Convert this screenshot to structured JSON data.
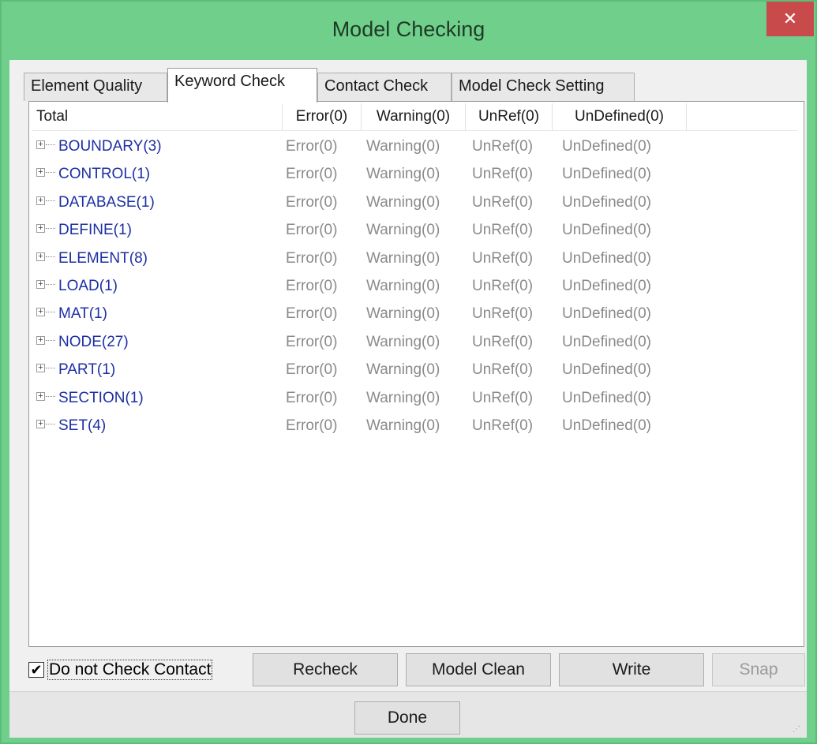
{
  "window": {
    "title": "Model Checking",
    "close_glyph": "✕"
  },
  "tabs": [
    {
      "label": "Element Quality"
    },
    {
      "label": "Keyword Check"
    },
    {
      "label": "Contact Check"
    },
    {
      "label": "Model Check Setting"
    }
  ],
  "active_tab": "Keyword Check",
  "columns": [
    "Total",
    "Error(0)",
    "Warning(0)",
    "UnRef(0)",
    "UnDefined(0)"
  ],
  "rows": [
    {
      "name": "BOUNDARY(3)",
      "error": "Error(0)",
      "warning": "Warning(0)",
      "unref": "UnRef(0)",
      "undefined": "UnDefined(0)"
    },
    {
      "name": "CONTROL(1)",
      "error": "Error(0)",
      "warning": "Warning(0)",
      "unref": "UnRef(0)",
      "undefined": "UnDefined(0)"
    },
    {
      "name": "DATABASE(1)",
      "error": "Error(0)",
      "warning": "Warning(0)",
      "unref": "UnRef(0)",
      "undefined": "UnDefined(0)"
    },
    {
      "name": "DEFINE(1)",
      "error": "Error(0)",
      "warning": "Warning(0)",
      "unref": "UnRef(0)",
      "undefined": "UnDefined(0)"
    },
    {
      "name": "ELEMENT(8)",
      "error": "Error(0)",
      "warning": "Warning(0)",
      "unref": "UnRef(0)",
      "undefined": "UnDefined(0)"
    },
    {
      "name": "LOAD(1)",
      "error": "Error(0)",
      "warning": "Warning(0)",
      "unref": "UnRef(0)",
      "undefined": "UnDefined(0)"
    },
    {
      "name": "MAT(1)",
      "error": "Error(0)",
      "warning": "Warning(0)",
      "unref": "UnRef(0)",
      "undefined": "UnDefined(0)"
    },
    {
      "name": "NODE(27)",
      "error": "Error(0)",
      "warning": "Warning(0)",
      "unref": "UnRef(0)",
      "undefined": "UnDefined(0)"
    },
    {
      "name": "PART(1)",
      "error": "Error(0)",
      "warning": "Warning(0)",
      "unref": "UnRef(0)",
      "undefined": "UnDefined(0)"
    },
    {
      "name": "SECTION(1)",
      "error": "Error(0)",
      "warning": "Warning(0)",
      "unref": "UnRef(0)",
      "undefined": "UnDefined(0)"
    },
    {
      "name": "SET(4)",
      "error": "Error(0)",
      "warning": "Warning(0)",
      "unref": "UnRef(0)",
      "undefined": "UnDefined(0)"
    }
  ],
  "controls": {
    "do_not_check_contact_label": "Do not Check Contact",
    "do_not_check_contact_checked": true,
    "checkmark_glyph": "✔",
    "recheck_label": "Recheck",
    "model_clean_label": "Model Clean",
    "write_label": "Write",
    "snap_label": "Snap",
    "snap_enabled": false
  },
  "footer": {
    "done_label": "Done"
  },
  "icons": {
    "expander": "plus-box-icon",
    "close": "close-icon",
    "check": "checkmark-icon"
  },
  "colors": {
    "titlebar": "#6fcf8b",
    "close_button": "#c94a4a",
    "tree_item_text": "#1c2fa3",
    "status_text": "#8a8a8a"
  }
}
